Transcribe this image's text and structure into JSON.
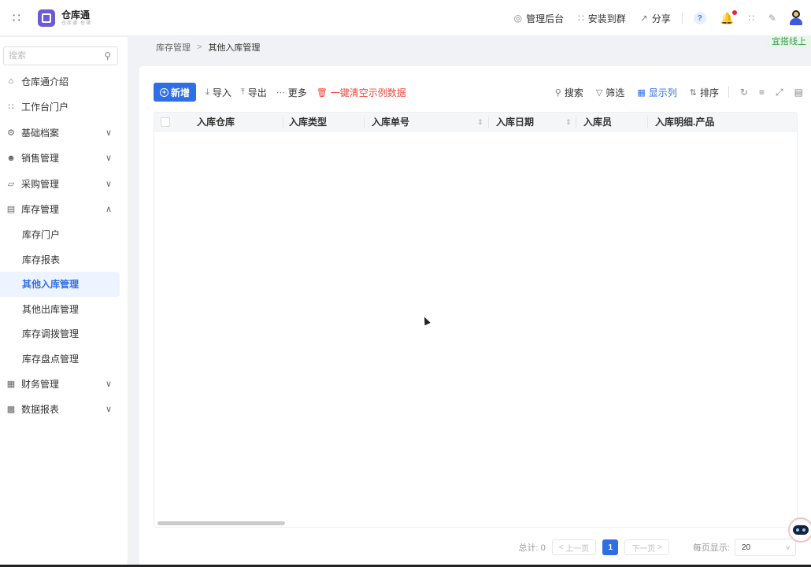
{
  "app": {
    "name": "仓库通",
    "subtitle": "仓库通·仓储"
  },
  "top_actions": [
    {
      "icon": "admin-icon",
      "label": "管理后台"
    },
    {
      "icon": "install-icon",
      "label": "安装到群"
    },
    {
      "icon": "share-icon",
      "label": "分享"
    }
  ],
  "help_label": "?",
  "live_badge": "宜搭线上",
  "sidebar": {
    "search_placeholder": "搜索",
    "items": [
      {
        "icon": "home-icon",
        "label": "仓库通介绍"
      },
      {
        "icon": "portal-icon",
        "label": "工作台门户"
      },
      {
        "icon": "archive-icon",
        "label": "基础档案"
      },
      {
        "icon": "sales-icon",
        "label": "销售管理"
      },
      {
        "icon": "purchase-icon",
        "label": "采购管理"
      },
      {
        "icon": "inventory-icon",
        "label": "库存管理"
      },
      {
        "icon": "finance-icon",
        "label": "财务管理"
      },
      {
        "icon": "report-icon",
        "label": "数据报表"
      }
    ],
    "sub_items": [
      {
        "label": "库存门户"
      },
      {
        "label": "库存报表"
      },
      {
        "label": "其他入库管理"
      },
      {
        "label": "其他出库管理"
      },
      {
        "label": "库存调拨管理"
      },
      {
        "label": "库存盘点管理"
      }
    ]
  },
  "breadcrumb": {
    "parent": "库存管理",
    "current": "其他入库管理"
  },
  "toolbar": {
    "new_label": "新增",
    "import_label": "导入",
    "export_label": "导出",
    "more_label": "更多",
    "clear_label": "一键清空示例数据",
    "search_label": "搜索",
    "filter_label": "筛选",
    "columns_label": "显示列",
    "sort_label": "排序"
  },
  "table": {
    "columns": [
      "入库仓库",
      "入库类型",
      "入库单号",
      "入库日期",
      "入库员",
      "入库明细.产品"
    ],
    "rows": []
  },
  "pagination": {
    "total_label": "总计: 0",
    "prev_label": "上一页",
    "current_page": "1",
    "next_label": "下一页",
    "page_size_label": "每页显示:",
    "page_size": "20"
  },
  "colors": {
    "accent": "#2f6fe5",
    "danger": "#f0473a",
    "active_bg": "#eef4ff"
  }
}
